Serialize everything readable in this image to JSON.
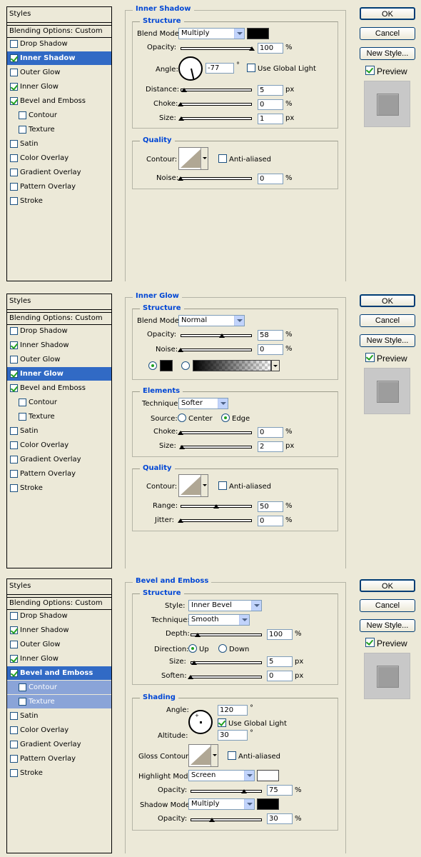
{
  "panels": [
    {
      "sidebar": {
        "header": "Styles",
        "blending": "Blending Options: Custom",
        "items": [
          "Drop Shadow",
          "Inner Shadow",
          "Outer Glow",
          "Inner Glow",
          "Bevel and Emboss",
          "Contour",
          "Texture",
          "Satin",
          "Color Overlay",
          "Gradient Overlay",
          "Pattern Overlay",
          "Stroke"
        ],
        "checked": [
          false,
          true,
          false,
          true,
          true,
          false,
          false,
          false,
          false,
          false,
          false,
          false
        ],
        "selected": 1
      },
      "section_title": "Inner Shadow",
      "structure": "Structure",
      "blend_mode_label": "Blend Mode:",
      "blend_mode": "Multiply",
      "opacity_label": "Opacity:",
      "opacity": "100",
      "opacity_pct": 1.0,
      "angle_label": "Angle:",
      "angle": "-77",
      "angle_unit": "°",
      "use_global": "Use Global Light",
      "distance_label": "Distance:",
      "distance": "5",
      "distance_pct": 0.05,
      "choke_label": "Choke:",
      "choke": "0",
      "choke_pct": 0,
      "size_label": "Size:",
      "size": "1",
      "size_pct": 0.01,
      "quality": "Quality",
      "contour_label": "Contour:",
      "anti_aliased": "Anti-aliased",
      "noise_label": "Noise:",
      "noise": "0",
      "noise_pct": 0,
      "px": "px",
      "pct": "%"
    },
    {
      "sidebar": {
        "header": "Styles",
        "blending": "Blending Options: Custom",
        "items": [
          "Drop Shadow",
          "Inner Shadow",
          "Outer Glow",
          "Inner Glow",
          "Bevel and Emboss",
          "Contour",
          "Texture",
          "Satin",
          "Color Overlay",
          "Gradient Overlay",
          "Pattern Overlay",
          "Stroke"
        ],
        "checked": [
          false,
          true,
          false,
          true,
          true,
          false,
          false,
          false,
          false,
          false,
          false,
          false
        ],
        "selected": 3
      },
      "section_title": "Inner Glow",
      "structure": "Structure",
      "blend_mode_label": "Blend Mode:",
      "blend_mode": "Normal",
      "opacity_label": "Opacity:",
      "opacity": "58",
      "opacity_pct": 0.58,
      "noise_label": "Noise:",
      "noise": "0",
      "noise_pct": 0,
      "elements": "Elements",
      "technique_label": "Technique:",
      "technique": "Softer",
      "source_label": "Source:",
      "center": "Center",
      "edge": "Edge",
      "choke_label": "Choke:",
      "choke": "0",
      "choke_pct": 0,
      "size_label": "Size:",
      "size": "2",
      "size_pct": 0.02,
      "quality": "Quality",
      "contour_label": "Contour:",
      "anti_aliased": "Anti-aliased",
      "range_label": "Range:",
      "range": "50",
      "range_pct": 0.5,
      "jitter_label": "Jitter:",
      "jitter": "0",
      "jitter_pct": 0,
      "px": "px",
      "pct": "%"
    },
    {
      "sidebar": {
        "header": "Styles",
        "blending": "Blending Options: Custom",
        "items": [
          "Drop Shadow",
          "Inner Shadow",
          "Outer Glow",
          "Inner Glow",
          "Bevel and Emboss",
          "Contour",
          "Texture",
          "Satin",
          "Color Overlay",
          "Gradient Overlay",
          "Pattern Overlay",
          "Stroke"
        ],
        "checked": [
          false,
          true,
          false,
          true,
          true,
          false,
          false,
          false,
          false,
          false,
          false,
          false
        ],
        "selected": 4
      },
      "section_title": "Bevel and Emboss",
      "structure": "Structure",
      "style_label": "Style:",
      "style": "Inner Bevel",
      "technique_label": "Technique:",
      "technique": "Smooth",
      "depth_label": "Depth:",
      "depth": "100",
      "depth_pct": 0.1,
      "direction_label": "Direction:",
      "up": "Up",
      "down": "Down",
      "size_label": "Size:",
      "size": "5",
      "size_pct": 0.05,
      "soften_label": "Soften:",
      "soften": "0",
      "soften_pct": 0,
      "shading": "Shading",
      "angle_label": "Angle:",
      "angle": "120",
      "angle_unit": "°",
      "use_global": "Use Global Light",
      "altitude_label": "Altitude:",
      "altitude": "30",
      "gloss_label": "Gloss Contour:",
      "anti_aliased": "Anti-aliased",
      "highlight_label": "Highlight Mode:",
      "highlight_mode": "Screen",
      "opacity_label": "Opacity:",
      "hl_opacity": "75",
      "hl_opacity_pct": 0.75,
      "shadow_label": "Shadow Mode:",
      "shadow_mode": "Multiply",
      "sh_opacity": "30",
      "sh_opacity_pct": 0.3,
      "px": "px",
      "pct": "%"
    }
  ],
  "buttons": {
    "ok": "OK",
    "cancel": "Cancel",
    "new_style": "New Style...",
    "preview": "Preview"
  }
}
